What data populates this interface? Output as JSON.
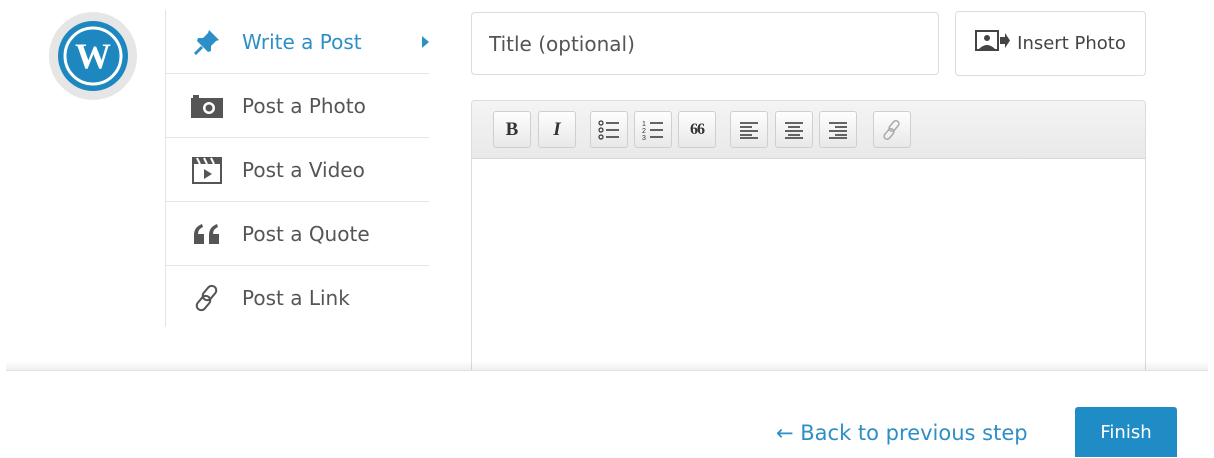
{
  "sidebar": {
    "items": [
      {
        "label": "Write a Post",
        "icon": "pin-icon",
        "active": true
      },
      {
        "label": "Post a Photo",
        "icon": "camera-icon"
      },
      {
        "label": "Post a Video",
        "icon": "video-icon"
      },
      {
        "label": "Post a Quote",
        "icon": "quote-icon"
      },
      {
        "label": "Post a Link",
        "icon": "link-icon"
      }
    ]
  },
  "editor": {
    "title_placeholder": "Title (optional)",
    "insert_photo_label": "Insert Photo",
    "toolbar": {
      "bold_label": "B",
      "italic_label": "I",
      "quote_label": "66"
    },
    "body": ""
  },
  "footer": {
    "back_label": "← Back to previous step",
    "finish_label": "Finish"
  },
  "colors": {
    "accent": "#2e8fc7",
    "button": "#1f8cc6",
    "logo": "#1e87bf"
  }
}
